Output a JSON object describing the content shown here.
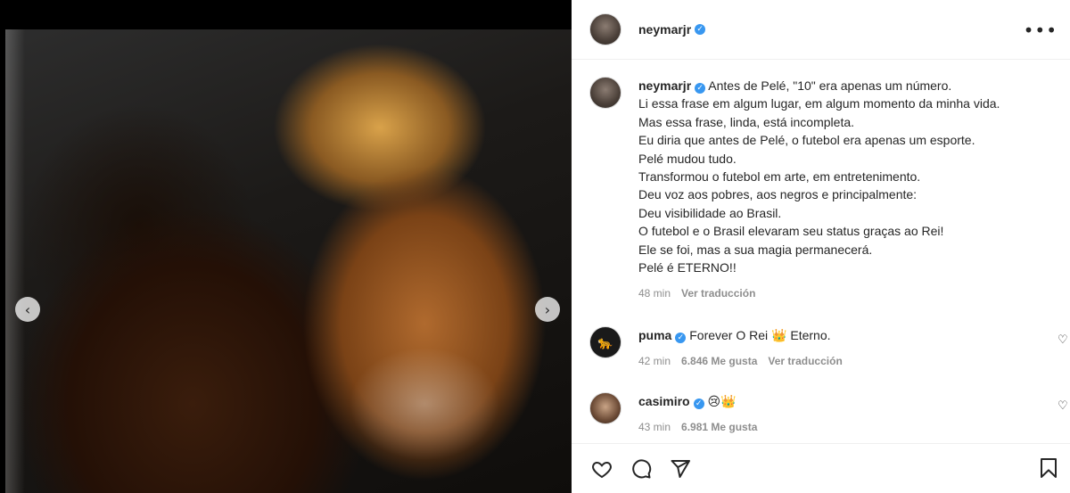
{
  "post": {
    "username": "neymarjr",
    "verified": true,
    "caption_lines": [
      "Antes de Pelé, \"10\" era apenas um número.",
      "Li essa frase em algum lugar, em algum momento da minha vida.",
      "Mas essa frase, linda, está incompleta.",
      "Eu diria que antes de Pelé, o futebol era apenas um esporte.",
      "Pelé mudou tudo.",
      "Transformou o futebol em arte, em entretenimento.",
      "Deu voz aos pobres, aos negros e principalmente:",
      "Deu visibilidade ao Brasil.",
      "O futebol e o Brasil elevaram seu status graças ao Rei!",
      "Ele se foi, mas a sua magia permanecerá.",
      "Pelé é ETERNO!!"
    ],
    "time": "48 min",
    "translate_label": "Ver traducción"
  },
  "comments": [
    {
      "username": "puma",
      "text": "Forever O Rei 👑 Eterno.",
      "time": "42 min",
      "likes": "6.846 Me gusta",
      "translate_label": "Ver traducción",
      "avatar_glyph": "🐆"
    },
    {
      "username": "casimiro",
      "text": "😢👑",
      "time": "43 min",
      "likes": "6.981 Me gusta"
    }
  ],
  "icons": {
    "more": "more-horizontal-icon",
    "heart": "heart-icon",
    "comment": "comment-icon",
    "share": "paper-plane-icon",
    "save": "bookmark-icon",
    "prev": "chevron-left-icon",
    "next": "chevron-right-icon",
    "verified": "verified-badge-icon"
  },
  "colors": {
    "verified": "#3897f0",
    "muted": "#8e8e8e",
    "text": "#262626"
  },
  "glyphs": {
    "more": "•••",
    "prev": "‹",
    "next": "›",
    "check": "✓",
    "heart_small": "♡"
  }
}
